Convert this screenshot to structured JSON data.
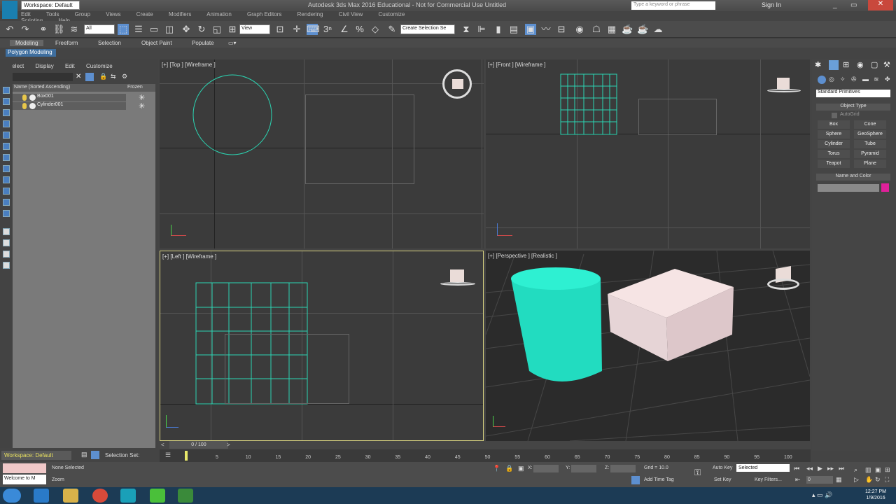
{
  "window": {
    "title": "Autodesk 3ds Max 2016 Educational - Not for Commercial Use    Untitled",
    "workspace": "Workspace: Default",
    "search_placeholder": "Type a keyword or phrase",
    "sign_in": "Sign In"
  },
  "menubar": [
    "Edit",
    "Tools",
    "Group",
    "Views",
    "Create",
    "Modifiers",
    "Animation",
    "Graph Editors",
    "Rendering",
    "Civil View",
    "Customize",
    "Scripting",
    "Help"
  ],
  "toolbar": {
    "filter_dropdown": "All",
    "refcoord_dropdown": "View",
    "selection_set_dropdown": "Create Selection Se"
  },
  "ribbon": {
    "tabs": [
      "Modeling",
      "Freeform",
      "Selection",
      "Object Paint",
      "Populate"
    ],
    "active": "Modeling",
    "sub": "Polygon Modeling"
  },
  "explorer": {
    "menu": [
      "Select",
      "Display",
      "Edit",
      "Customize"
    ],
    "col_name": "Name (Sorted Ascending)",
    "col_frozen": "Frozen",
    "rows": [
      "Box001",
      "Cylinder001"
    ]
  },
  "viewports": {
    "top": "[+] [Top ] [Wireframe ]",
    "front": "[+] [Front ] [Wireframe ]",
    "left": "[+] [Left ] [Wireframe ]",
    "perspective": "[+] [Perspective ] [Realistic ]"
  },
  "command_panel": {
    "dropdown": "Standard Primitives",
    "object_type": "Object Type",
    "autogrid": "AutoGrid",
    "buttons": [
      "Box",
      "Cone",
      "Sphere",
      "GeoSphere",
      "Cylinder",
      "Tube",
      "Torus",
      "Pyramid",
      "Teapot",
      "Plane"
    ],
    "name_color": "Name and Color"
  },
  "timeline": {
    "frame": "0 / 100",
    "ticks": [
      "5",
      "10",
      "15",
      "20",
      "25",
      "30",
      "35",
      "40",
      "45",
      "50",
      "55",
      "60",
      "65",
      "70",
      "75",
      "80",
      "85",
      "90",
      "95",
      "100"
    ]
  },
  "status": {
    "workspace": "Workspace: Default",
    "selection_set": "Selection Set:",
    "none_selected": "None Selected",
    "welcome": "Welcome to M",
    "zoom": "Zoom",
    "x_label": "X:",
    "y_label": "Y:",
    "z_label": "Z:",
    "grid": "Grid = 10.0",
    "add_time_tag": "Add Time Tag",
    "auto_key": "Auto Key",
    "selected_dd": "Selected",
    "set_key": "Set Key",
    "key_filters": "Key Filters...",
    "frame_field": "0"
  },
  "taskbar": {
    "time": "12:27 PM",
    "date": "1/9/2016"
  },
  "colors": {
    "cylinder": "#2de8c9",
    "box": "#f3d9dc",
    "wire": "#2bd6b3",
    "active_border": "#d8d280"
  }
}
